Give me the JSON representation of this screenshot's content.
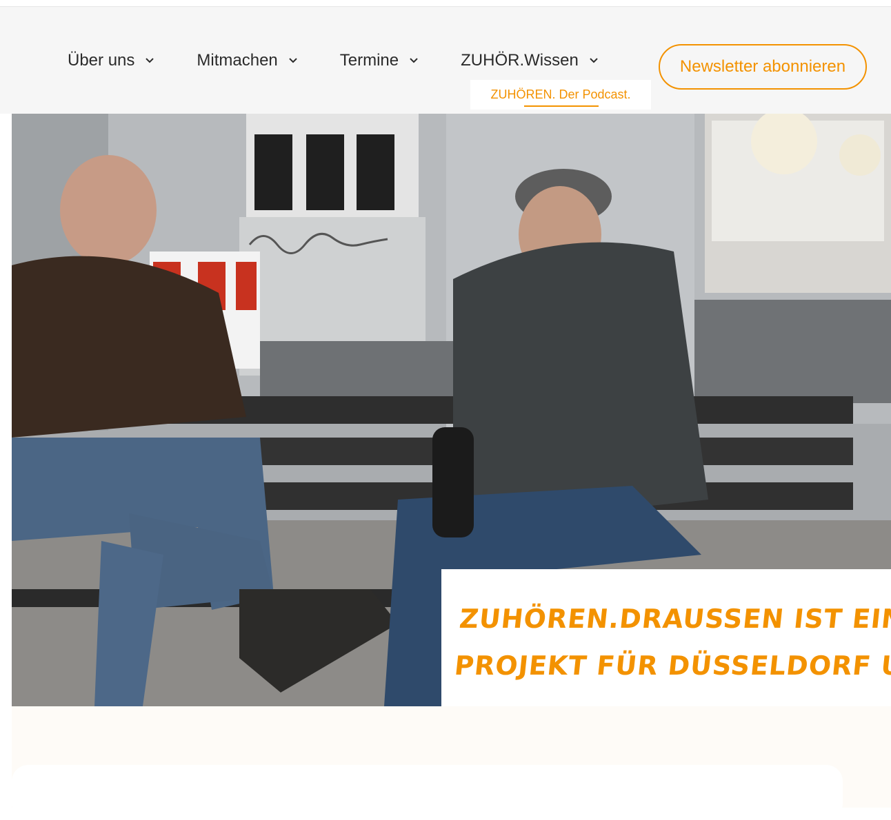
{
  "nav": {
    "items": [
      {
        "label": "Über uns"
      },
      {
        "label": "Mitmachen"
      },
      {
        "label": "Termine"
      },
      {
        "label": "ZUHÖR.Wissen"
      }
    ],
    "newsletter_label": "Newsletter abonnieren",
    "submenu_label": "ZUHÖREN. Der Podcast."
  },
  "hero": {
    "caption_line1": "ZUHÖREN.DRAUSSEN IST EIN SOZIO",
    "caption_line2": "PROJEKT FÜR DÜSSELDORF UND UM"
  },
  "colors": {
    "accent": "#f39200",
    "header_bg": "#f6f6f6",
    "section_bg": "#fefbf7"
  },
  "icons": {
    "chevron": "chevron-down-icon"
  }
}
